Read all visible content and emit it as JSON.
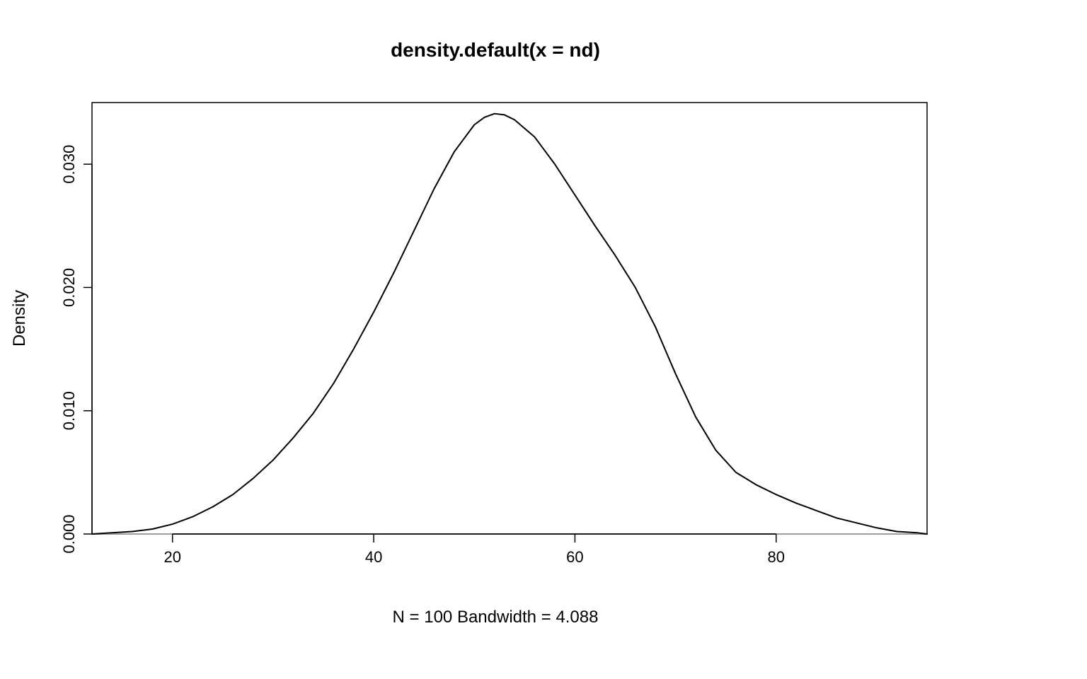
{
  "chart_data": {
    "type": "line",
    "title": "density.default(x = nd)",
    "xlabel": "N = 100   Bandwidth = 4.088",
    "ylabel": "Density",
    "xlim": [
      12,
      95
    ],
    "ylim": [
      0,
      0.035
    ],
    "x_ticks": [
      20,
      40,
      60,
      80
    ],
    "y_ticks": [
      0.0,
      0.01,
      0.02,
      0.03
    ],
    "y_tick_labels": [
      "0.000",
      "0.010",
      "0.020",
      "0.030"
    ],
    "series": [
      {
        "name": "density",
        "x": [
          12,
          14,
          16,
          18,
          20,
          22,
          24,
          26,
          28,
          30,
          32,
          34,
          36,
          38,
          40,
          42,
          44,
          46,
          48,
          50,
          51,
          52,
          53,
          54,
          56,
          58,
          60,
          62,
          64,
          66,
          68,
          70,
          72,
          74,
          76,
          78,
          80,
          82,
          84,
          86,
          88,
          90,
          92,
          94,
          95
        ],
        "y": [
          0.0,
          0.0001,
          0.0002,
          0.0004,
          0.0008,
          0.0014,
          0.0022,
          0.0032,
          0.0045,
          0.006,
          0.0078,
          0.0098,
          0.0122,
          0.015,
          0.018,
          0.0212,
          0.0246,
          0.028,
          0.031,
          0.0332,
          0.0338,
          0.0341,
          0.034,
          0.0336,
          0.0322,
          0.03,
          0.0275,
          0.025,
          0.0226,
          0.02,
          0.0168,
          0.013,
          0.0095,
          0.0068,
          0.005,
          0.004,
          0.0032,
          0.0025,
          0.0019,
          0.0013,
          0.0009,
          0.0005,
          0.0002,
          0.0001,
          0.0
        ]
      }
    ]
  }
}
